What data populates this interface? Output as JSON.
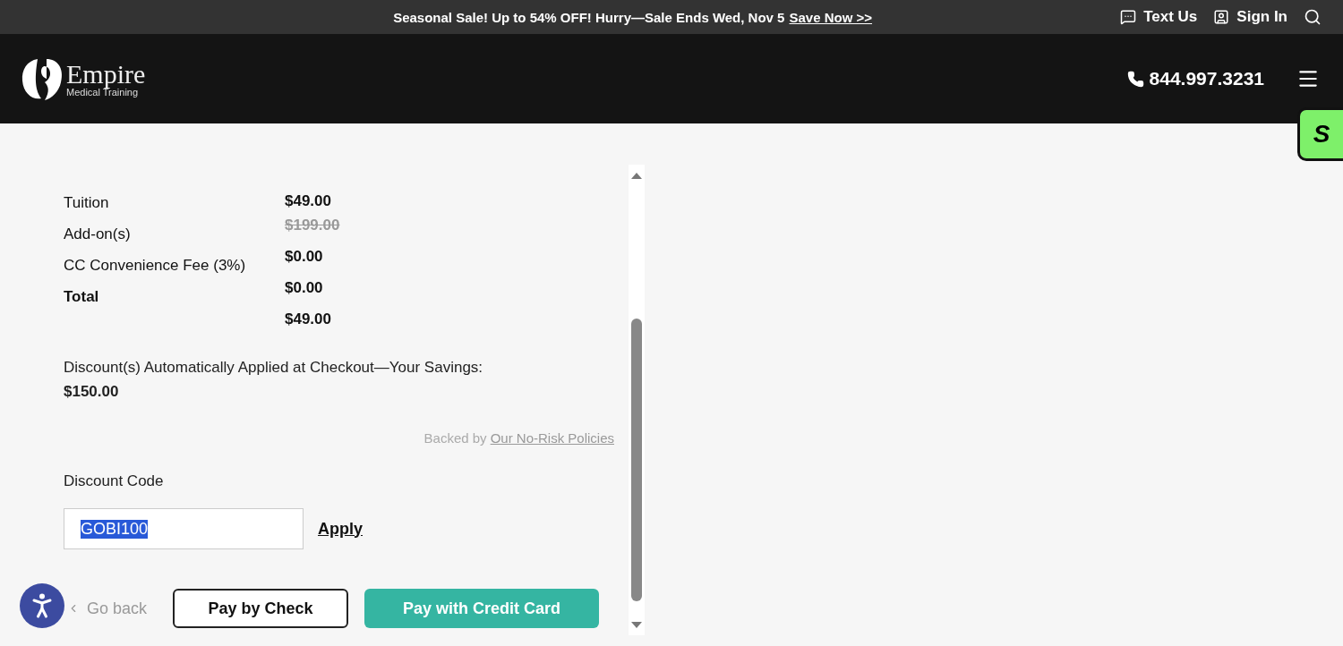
{
  "promo_bar": {
    "message": "Seasonal Sale! Up to 54% OFF! Hurry—Sale Ends Wed, Nov 5",
    "link": "Save Now >>",
    "actions": [
      {
        "label": "Text Us",
        "kind": "chat"
      },
      {
        "label": "Sign In",
        "kind": "user"
      }
    ]
  },
  "header": {
    "logo": {
      "name": "Empire",
      "sub_left": "Medical",
      "sub_right": "Training"
    },
    "phone": "844.997.3231"
  },
  "side_badge": {
    "label": "S"
  },
  "summary": {
    "labels": [
      {
        "text": "Tuition",
        "bold": false
      },
      {
        "text": "Add-on(s)",
        "bold": false
      },
      {
        "text": "CC Convenience Fee (3%)",
        "bold": false
      },
      {
        "text": "Total",
        "bold": true
      }
    ],
    "amounts": [
      {
        "text": "$49.00",
        "struck": false
      },
      {
        "text": "$199.00",
        "struck": true
      },
      {
        "text": "$0.00",
        "struck": false
      },
      {
        "text": "$0.00",
        "struck": false
      },
      {
        "text": "$49.00",
        "struck": false
      }
    ]
  },
  "savings": {
    "note": "Discount(s) Automatically Applied at Checkout—Your Savings:",
    "amount": "$150.00"
  },
  "policy": {
    "prefix": "Backed by",
    "link": "Our No-Risk Policies"
  },
  "discount": {
    "label": "Discount Code",
    "value": "GOBI100",
    "text_selected": true,
    "apply": "Apply"
  },
  "actions": {
    "back": "Go back",
    "check": "Pay by Check",
    "card": "Pay with Credit Card"
  }
}
